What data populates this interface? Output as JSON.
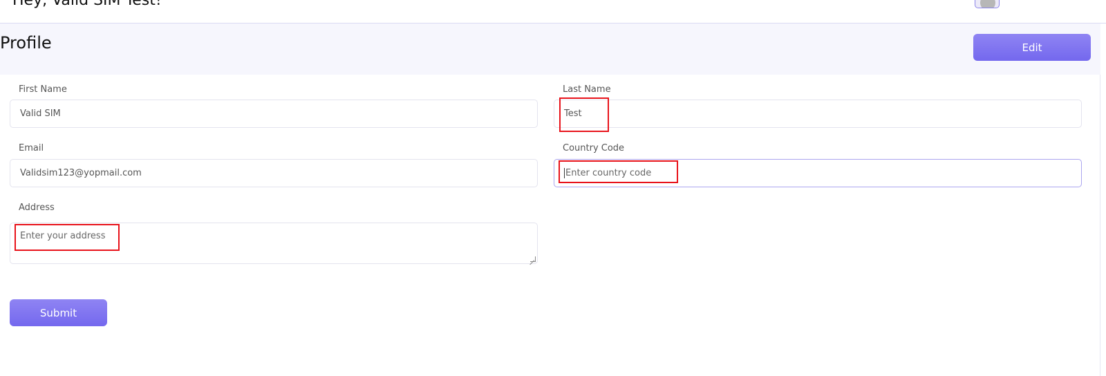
{
  "header": {
    "greeting": "Hey, Valid SIM Test!"
  },
  "profile": {
    "title": "Profile",
    "edit_label": "Edit"
  },
  "form": {
    "first_name": {
      "label": "First Name",
      "value": "Valid SIM"
    },
    "last_name": {
      "label": "Last Name",
      "value": "Test"
    },
    "email": {
      "label": "Email",
      "value": "Validsim123@yopmail.com"
    },
    "country_code": {
      "label": "Country Code",
      "placeholder": "Enter country code"
    },
    "address": {
      "label": "Address",
      "placeholder": "Enter your address"
    },
    "submit_label": "Submit"
  },
  "colors": {
    "accent": "#7a6ff0",
    "highlight": "#e8121a",
    "header_bg": "#f6f6fd"
  }
}
